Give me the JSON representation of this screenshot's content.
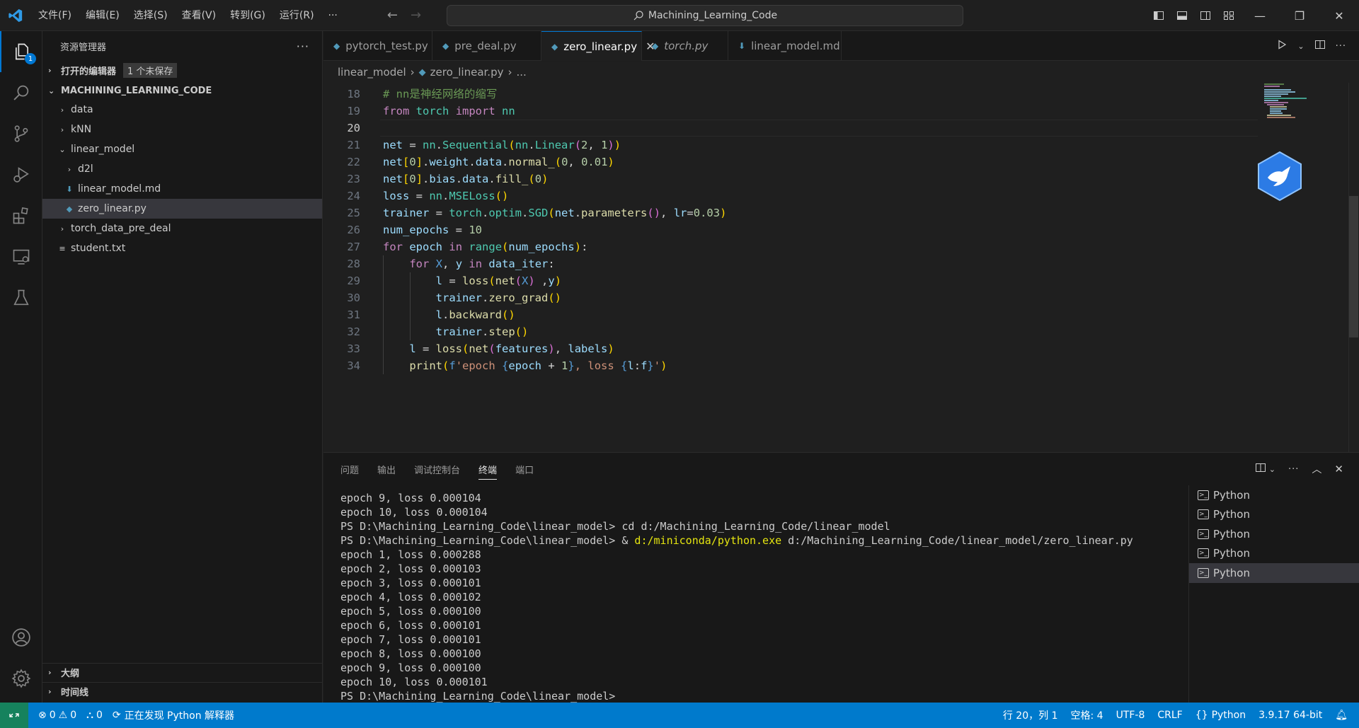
{
  "titlebar": {
    "menu": [
      "文件(F)",
      "编辑(E)",
      "选择(S)",
      "查看(V)",
      "转到(G)",
      "运行(R)",
      "···"
    ],
    "search_text": "Machining_Learning_Code"
  },
  "activity": {
    "explorer_badge": "1"
  },
  "sidebar": {
    "title": "资源管理器",
    "more": "···",
    "open_editors": "打开的编辑器",
    "unsaved": "1 个未保存",
    "folder": "MACHINING_LEARNING_CODE",
    "tree": [
      {
        "label": "data",
        "kind": "folder",
        "depth": 1
      },
      {
        "label": "kNN",
        "kind": "folder",
        "depth": 1
      },
      {
        "label": "linear_model",
        "kind": "folder-open",
        "depth": 1
      },
      {
        "label": "d2l",
        "kind": "folder",
        "depth": 2
      },
      {
        "label": "linear_model.md",
        "kind": "md",
        "depth": 2
      },
      {
        "label": "zero_linear.py",
        "kind": "py",
        "depth": 2
      },
      {
        "label": "torch_data_pre_deal",
        "kind": "folder",
        "depth": 1
      },
      {
        "label": "student.txt",
        "kind": "txt",
        "depth": 1
      }
    ],
    "outline": "大纲",
    "timeline": "时间线"
  },
  "tabs": [
    {
      "label": "pytorch_test.py",
      "active": false,
      "italic": false,
      "dirty": false
    },
    {
      "label": "pre_deal.py",
      "active": false,
      "italic": false,
      "dirty": false
    },
    {
      "label": "zero_linear.py",
      "active": true,
      "italic": false,
      "dirty": false
    },
    {
      "label": "torch.py",
      "active": false,
      "italic": true,
      "dirty": false
    },
    {
      "label": "linear_model.md",
      "active": false,
      "italic": false,
      "dirty": true
    }
  ],
  "breadcrumb": {
    "folder": "linear_model",
    "file": "zero_linear.py",
    "more": "..."
  },
  "editor": {
    "current_line": 20,
    "lines": [
      {
        "n": "18",
        "tokens": [
          [
            "cm",
            "# nn是神经网络的缩写"
          ]
        ]
      },
      {
        "n": "19",
        "tokens": [
          [
            "kw",
            "from"
          ],
          [
            "txt",
            " "
          ],
          [
            "cls",
            "torch"
          ],
          [
            "txt",
            " "
          ],
          [
            "kw",
            "import"
          ],
          [
            "txt",
            " "
          ],
          [
            "cls",
            "nn"
          ]
        ]
      },
      {
        "n": "20",
        "tokens": []
      },
      {
        "n": "21",
        "tokens": [
          [
            "var",
            "net"
          ],
          [
            "txt",
            " = "
          ],
          [
            "cls",
            "nn"
          ],
          [
            "txt",
            "."
          ],
          [
            "cls",
            "Sequential"
          ],
          [
            "b1",
            "("
          ],
          [
            "cls",
            "nn"
          ],
          [
            "txt",
            "."
          ],
          [
            "cls",
            "Linear"
          ],
          [
            "b2",
            "("
          ],
          [
            "num",
            "2"
          ],
          [
            "txt",
            ", "
          ],
          [
            "num",
            "1"
          ],
          [
            "b2",
            ")"
          ],
          [
            "b1",
            ")"
          ]
        ]
      },
      {
        "n": "22",
        "tokens": [
          [
            "var",
            "net"
          ],
          [
            "b1",
            "["
          ],
          [
            "num",
            "0"
          ],
          [
            "b1",
            "]"
          ],
          [
            "txt",
            "."
          ],
          [
            "var",
            "weight"
          ],
          [
            "txt",
            "."
          ],
          [
            "var",
            "data"
          ],
          [
            "txt",
            "."
          ],
          [
            "fn",
            "normal_"
          ],
          [
            "b1",
            "("
          ],
          [
            "num",
            "0"
          ],
          [
            "txt",
            ", "
          ],
          [
            "num",
            "0.01"
          ],
          [
            "b1",
            ")"
          ]
        ]
      },
      {
        "n": "23",
        "tokens": [
          [
            "var",
            "net"
          ],
          [
            "b1",
            "["
          ],
          [
            "num",
            "0"
          ],
          [
            "b1",
            "]"
          ],
          [
            "txt",
            "."
          ],
          [
            "var",
            "bias"
          ],
          [
            "txt",
            "."
          ],
          [
            "var",
            "data"
          ],
          [
            "txt",
            "."
          ],
          [
            "fn",
            "fill_"
          ],
          [
            "b1",
            "("
          ],
          [
            "num",
            "0"
          ],
          [
            "b1",
            ")"
          ]
        ]
      },
      {
        "n": "24",
        "tokens": [
          [
            "var",
            "loss"
          ],
          [
            "txt",
            " = "
          ],
          [
            "cls",
            "nn"
          ],
          [
            "txt",
            "."
          ],
          [
            "cls",
            "MSELoss"
          ],
          [
            "b1",
            "()"
          ]
        ]
      },
      {
        "n": "25",
        "tokens": [
          [
            "var",
            "trainer"
          ],
          [
            "txt",
            " = "
          ],
          [
            "cls",
            "torch"
          ],
          [
            "txt",
            "."
          ],
          [
            "cls",
            "optim"
          ],
          [
            "txt",
            "."
          ],
          [
            "cls",
            "SGD"
          ],
          [
            "b1",
            "("
          ],
          [
            "var",
            "net"
          ],
          [
            "txt",
            "."
          ],
          [
            "fn",
            "parameters"
          ],
          [
            "b2",
            "()"
          ],
          [
            "txt",
            ", "
          ],
          [
            "var",
            "lr"
          ],
          [
            "txt",
            "="
          ],
          [
            "num",
            "0.03"
          ],
          [
            "b1",
            ")"
          ]
        ]
      },
      {
        "n": "26",
        "tokens": [
          [
            "var",
            "num_epochs"
          ],
          [
            "txt",
            " = "
          ],
          [
            "num",
            "10"
          ]
        ]
      },
      {
        "n": "27",
        "tokens": [
          [
            "kw",
            "for"
          ],
          [
            "txt",
            " "
          ],
          [
            "var",
            "epoch"
          ],
          [
            "txt",
            " "
          ],
          [
            "kw",
            "in"
          ],
          [
            "txt",
            " "
          ],
          [
            "cls",
            "range"
          ],
          [
            "b1",
            "("
          ],
          [
            "var",
            "num_epochs"
          ],
          [
            "b1",
            ")"
          ],
          [
            "txt",
            ":"
          ]
        ]
      },
      {
        "n": "28",
        "tokens": [
          [
            "txt",
            "    "
          ],
          [
            "kw",
            "for"
          ],
          [
            "txt",
            " "
          ],
          [
            "kw2",
            "X"
          ],
          [
            "txt",
            ", "
          ],
          [
            "var",
            "y"
          ],
          [
            "txt",
            " "
          ],
          [
            "kw",
            "in"
          ],
          [
            "txt",
            " "
          ],
          [
            "var",
            "data_iter"
          ],
          [
            "txt",
            ":"
          ]
        ]
      },
      {
        "n": "29",
        "tokens": [
          [
            "txt",
            "        "
          ],
          [
            "var",
            "l"
          ],
          [
            "txt",
            " = "
          ],
          [
            "fn",
            "loss"
          ],
          [
            "b1",
            "("
          ],
          [
            "fn",
            "net"
          ],
          [
            "b2",
            "("
          ],
          [
            "kw2",
            "X"
          ],
          [
            "b2",
            ")"
          ],
          [
            "txt",
            " ,"
          ],
          [
            "var",
            "y"
          ],
          [
            "b1",
            ")"
          ]
        ]
      },
      {
        "n": "30",
        "tokens": [
          [
            "txt",
            "        "
          ],
          [
            "var",
            "trainer"
          ],
          [
            "txt",
            "."
          ],
          [
            "fn",
            "zero_grad"
          ],
          [
            "b1",
            "()"
          ]
        ]
      },
      {
        "n": "31",
        "tokens": [
          [
            "txt",
            "        "
          ],
          [
            "var",
            "l"
          ],
          [
            "txt",
            "."
          ],
          [
            "fn",
            "backward"
          ],
          [
            "b1",
            "()"
          ]
        ]
      },
      {
        "n": "32",
        "tokens": [
          [
            "txt",
            "        "
          ],
          [
            "var",
            "trainer"
          ],
          [
            "txt",
            "."
          ],
          [
            "fn",
            "step"
          ],
          [
            "b1",
            "()"
          ]
        ]
      },
      {
        "n": "33",
        "tokens": [
          [
            "txt",
            "    "
          ],
          [
            "var",
            "l"
          ],
          [
            "txt",
            " = "
          ],
          [
            "fn",
            "loss"
          ],
          [
            "b1",
            "("
          ],
          [
            "fn",
            "net"
          ],
          [
            "b2",
            "("
          ],
          [
            "var",
            "features"
          ],
          [
            "b2",
            ")"
          ],
          [
            "txt",
            ", "
          ],
          [
            "var",
            "labels"
          ],
          [
            "b1",
            ")"
          ]
        ]
      },
      {
        "n": "34",
        "tokens": [
          [
            "txt",
            "    "
          ],
          [
            "fn",
            "print"
          ],
          [
            "b1",
            "("
          ],
          [
            "kw2",
            "f"
          ],
          [
            "str",
            "'epoch "
          ],
          [
            "kw2",
            "{"
          ],
          [
            "var",
            "epoch"
          ],
          [
            "txt",
            " + "
          ],
          [
            "num",
            "1"
          ],
          [
            "kw2",
            "}"
          ],
          [
            "str",
            ", loss "
          ],
          [
            "kw2",
            "{"
          ],
          [
            "var",
            "l"
          ],
          [
            "txt",
            ":"
          ],
          [
            "var",
            "f"
          ],
          [
            "kw2",
            "}"
          ],
          [
            "str",
            "'"
          ],
          [
            "b1",
            ")"
          ]
        ]
      }
    ]
  },
  "panel": {
    "tabs": [
      "问题",
      "输出",
      "调试控制台",
      "终端",
      "端口"
    ],
    "active_tab": "终端",
    "terminal_lines": [
      [
        [
          "t",
          "epoch 9, loss 0.000104"
        ]
      ],
      [
        [
          "t",
          "epoch 10, loss 0.000104"
        ]
      ],
      [
        [
          "t",
          "PS D:\\Machining_Learning_Code\\linear_model> cd d:/Machining_Learning_Code/linear_model"
        ]
      ],
      [
        [
          "t",
          "PS D:\\Machining_Learning_Code\\linear_model> & "
        ],
        [
          "y",
          "d:/miniconda/python.exe"
        ],
        [
          "t",
          " d:/Machining_Learning_Code/linear_model/zero_linear.py"
        ]
      ],
      [
        [
          "t",
          "epoch 1, loss 0.000288"
        ]
      ],
      [
        [
          "t",
          "epoch 2, loss 0.000103"
        ]
      ],
      [
        [
          "t",
          "epoch 3, loss 0.000101"
        ]
      ],
      [
        [
          "t",
          "epoch 4, loss 0.000102"
        ]
      ],
      [
        [
          "t",
          "epoch 5, loss 0.000100"
        ]
      ],
      [
        [
          "t",
          "epoch 6, loss 0.000101"
        ]
      ],
      [
        [
          "t",
          "epoch 7, loss 0.000101"
        ]
      ],
      [
        [
          "t",
          "epoch 8, loss 0.000100"
        ]
      ],
      [
        [
          "t",
          "epoch 9, loss 0.000100"
        ]
      ],
      [
        [
          "t",
          "epoch 10, loss 0.000101"
        ]
      ],
      [
        [
          "t",
          "PS D:\\Machining_Learning_Code\\linear_model>"
        ]
      ]
    ],
    "terminals": [
      "Python",
      "Python",
      "Python",
      "Python",
      "Python"
    ],
    "selected_terminal": 4
  },
  "statusbar": {
    "errors": "0",
    "warnings": "0",
    "ports": "0",
    "discovering": "正在发现 Python 解释器",
    "position": "行 20，列 1",
    "spaces": "空格: 4",
    "encoding": "UTF-8",
    "eol": "CRLF",
    "language": "Python",
    "interpreter": "3.9.17 64-bit"
  },
  "colors": {
    "accent": "#0078d4",
    "statusbar": "#007acc",
    "remote": "#16825d"
  }
}
